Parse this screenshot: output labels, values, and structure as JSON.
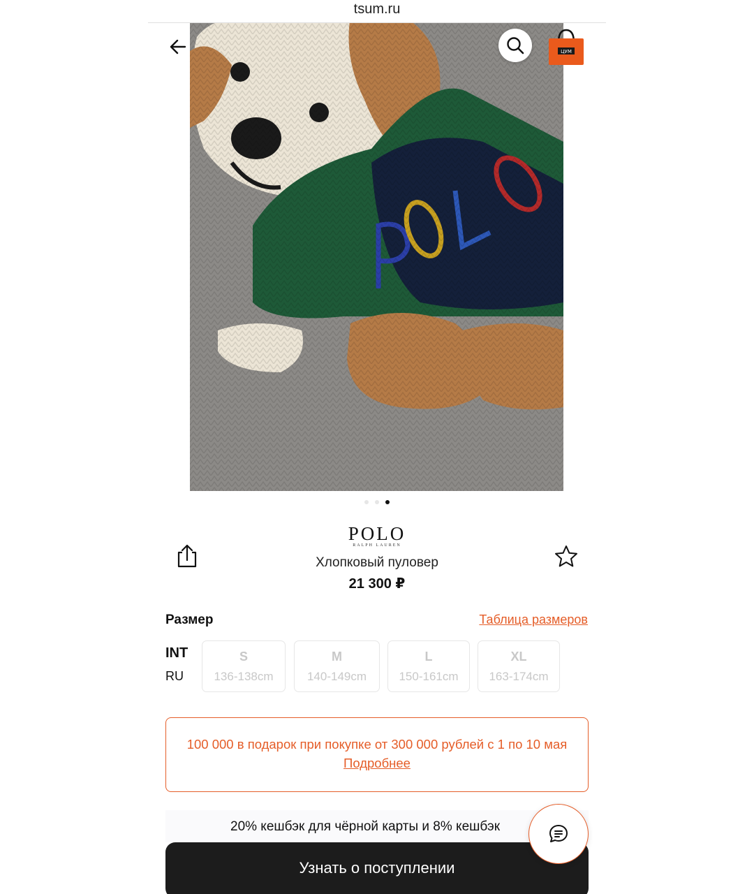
{
  "browser": {
    "url": "tsum.ru"
  },
  "header": {
    "back_icon": "arrow-left-icon",
    "search_icon": "search-icon",
    "bag_icon": "shopping-bag-icon",
    "bag_badge": "ЦУМ"
  },
  "gallery": {
    "slide_count": 3,
    "active_index": 2
  },
  "product": {
    "brand_main": "POLO",
    "brand_sub": "RALPH LAUREN",
    "name": "Хлопковый пуловер",
    "price": "21 300 ₽",
    "share_icon": "share-icon",
    "favorite_icon": "star-icon"
  },
  "sizes": {
    "label": "Размер",
    "table_link": "Таблица размеров",
    "system_int": "INT",
    "system_ru": "RU",
    "options": [
      {
        "int": "S",
        "ru": "136-138cm"
      },
      {
        "int": "M",
        "ru": "140-149cm"
      },
      {
        "int": "L",
        "ru": "150-161cm"
      },
      {
        "int": "XL",
        "ru": "163-174cm"
      }
    ]
  },
  "promo": {
    "text": "100 000 в подарок при покупке от 300 000 рублей с 1 по 10 мая",
    "link": "Подробнее"
  },
  "cashback": {
    "text": "20% кешбэк для чёрной карты и 8% кешбэк"
  },
  "cta": {
    "label": "Узнать о поступлении"
  },
  "chat": {
    "icon": "chat-icon"
  },
  "colors": {
    "accent": "#e55d28",
    "button_dark": "#1c1c1c"
  }
}
